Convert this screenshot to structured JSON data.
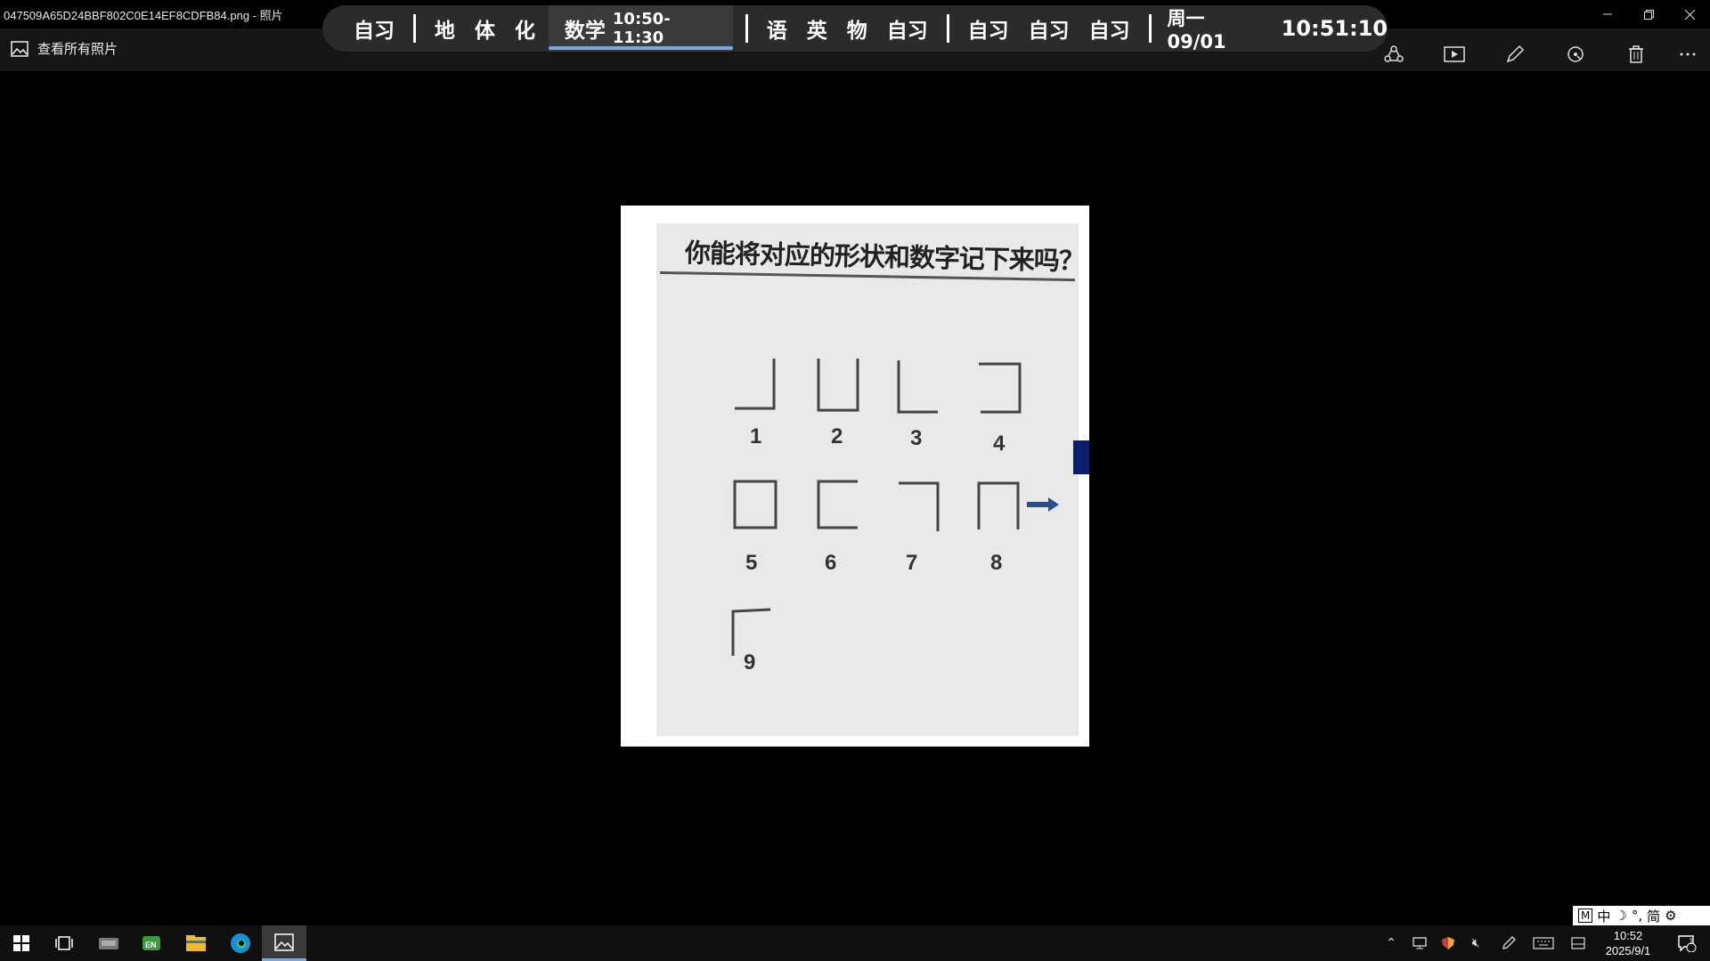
{
  "window": {
    "title": "047509A65D24BBF802C0E14EF8CDFB84.png - 照片",
    "minimize_icon": "minimize-icon",
    "maximize_icon": "restore-icon",
    "close_icon": "close-icon"
  },
  "toolbar": {
    "see_all_label": "查看所有照片",
    "actions": [
      "share-icon",
      "slideshow-icon",
      "edit-icon",
      "rotate-icon",
      "delete-icon",
      "more-icon"
    ]
  },
  "schedule": {
    "items_a": [
      "自习"
    ],
    "items_b": [
      "地",
      "体",
      "化"
    ],
    "current_subject": "数学",
    "current_time": "10:50-11:30",
    "items_c": [
      "语",
      "英",
      "物",
      "自习"
    ],
    "items_d": [
      "自习",
      "自习",
      "自习"
    ],
    "date": "周一 09/01",
    "clock": "10:51:10",
    "accent": "#7aa7e0"
  },
  "photo": {
    "title": "你能将对应的形状和数字记下来吗？",
    "labels": [
      "1",
      "2",
      "3",
      "4",
      "5",
      "6",
      "7",
      "8",
      "9"
    ]
  },
  "taskbar": {
    "apps": [
      "start-icon",
      "task-view-icon",
      "keyboard-app-icon",
      "en-app-icon",
      "file-explorer-icon",
      "edge-icon",
      "photos-icon"
    ],
    "tray": [
      "chevron-up-icon",
      "network-icon",
      "security-icon",
      "mute-icon",
      "pen-icon",
      "touch-keyboard-icon",
      "tablet-icon"
    ],
    "time": "10:52",
    "date": "2025/9/1",
    "notification_count": "1"
  },
  "ime": {
    "mode_box": "M",
    "lang": "中",
    "punct": "°,",
    "script": "简"
  }
}
